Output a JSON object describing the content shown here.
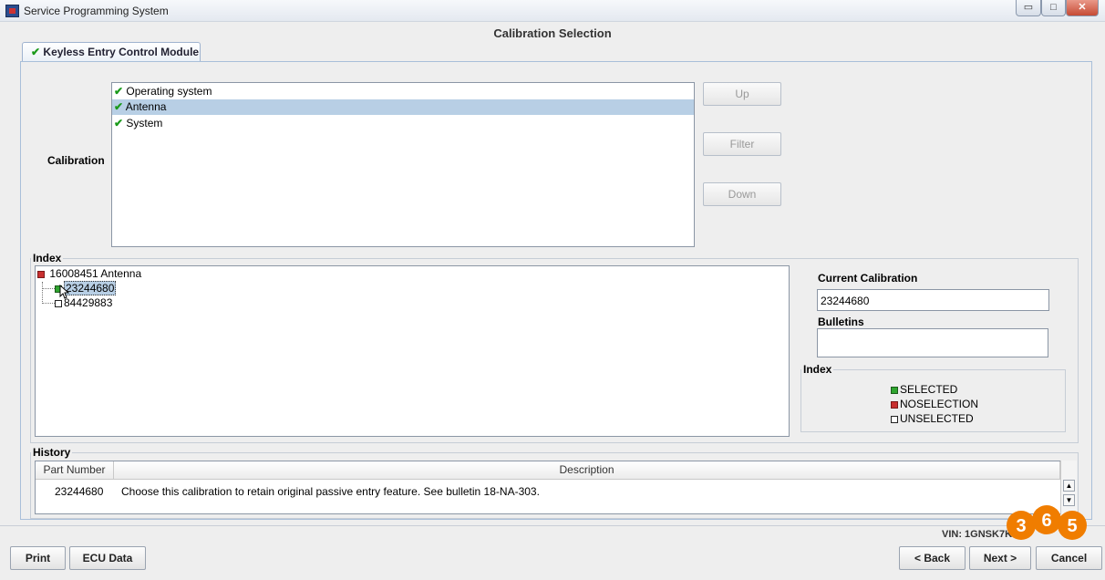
{
  "window": {
    "title": "Service Programming System",
    "controls": {
      "minimize": "▭",
      "maximize": "□",
      "close": "✕"
    }
  },
  "panel": {
    "title": "Calibration Selection"
  },
  "tab": {
    "check": "✔",
    "label": "Keyless Entry Control Module"
  },
  "calibration": {
    "label": "Calibration",
    "items": [
      {
        "check": "✔",
        "label": "Operating system",
        "selected": false
      },
      {
        "check": "✔",
        "label": "Antenna",
        "selected": true
      },
      {
        "check": "✔",
        "label": "System",
        "selected": false
      }
    ],
    "buttons": {
      "up": "Up",
      "filter": "Filter",
      "down": "Down"
    }
  },
  "index": {
    "legend": "Index",
    "tree": {
      "root": "16008451 Antenna",
      "children": [
        "23244680",
        "84429883"
      ]
    }
  },
  "current_calibration": {
    "label": "Current Calibration",
    "value": "23244680"
  },
  "bulletins": {
    "label": "Bulletins",
    "value": ""
  },
  "index_legend": {
    "legend": "Index",
    "items": [
      "SELECTED",
      "NOSELECTION",
      "UNSELECTED"
    ]
  },
  "history": {
    "legend": "History",
    "columns": [
      "Part Number",
      "Description"
    ],
    "rows": [
      {
        "part_number": "23244680",
        "description": "Choose this calibration to retain original passive entry feature. See bulletin 18-NA-303."
      }
    ]
  },
  "status": {
    "vin": "VIN: 1GNSK7K"
  },
  "footer": {
    "print": "Print",
    "ecu_data": "ECU Data",
    "back": "< Back",
    "next": "Next >",
    "cancel": "Cancel"
  },
  "colors": {
    "selection": "#b8cfe5",
    "check": "#1b9a1b",
    "noselection": "#c93030",
    "watermark": "#f07d00"
  }
}
